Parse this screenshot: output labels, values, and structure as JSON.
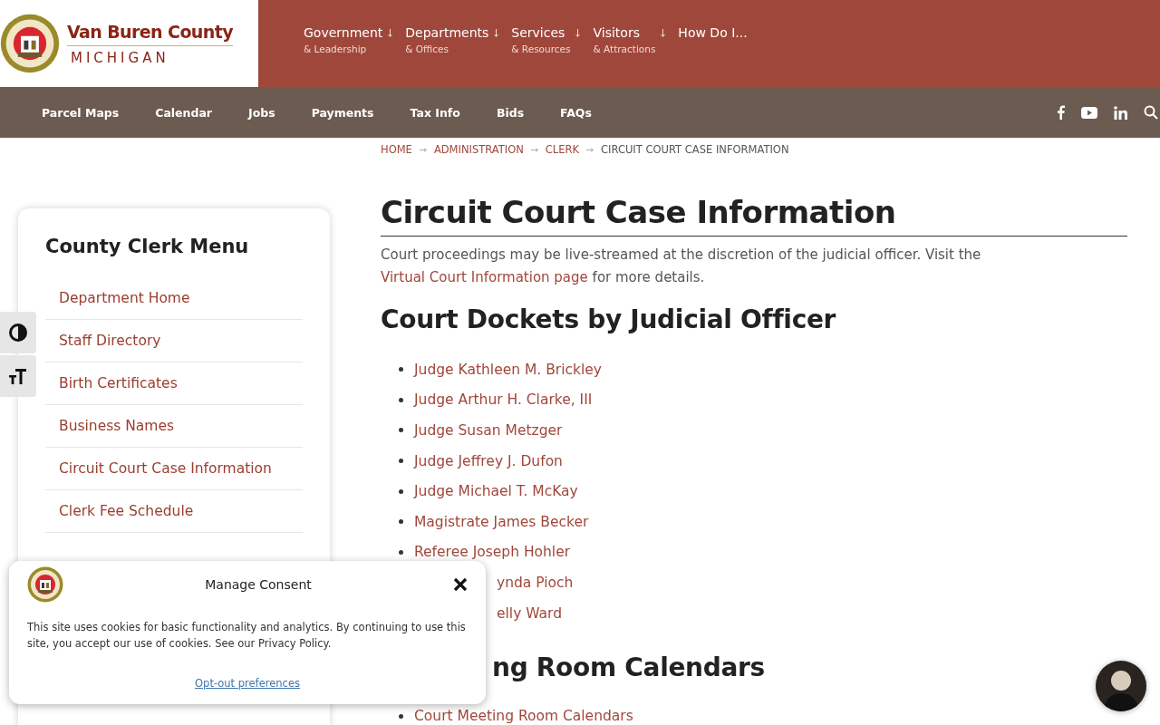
{
  "header": {
    "logo_title": "Van Buren County",
    "logo_subtitle": "MICHIGAN",
    "menu": [
      {
        "label": "Government",
        "sublabel": "& Leadership",
        "dropdown": true
      },
      {
        "label": "Departments",
        "sublabel": "& Offices",
        "dropdown": true
      },
      {
        "label": "Services",
        "sublabel": "& Resources",
        "dropdown": true
      },
      {
        "label": "Visitors",
        "sublabel": "& Attractions",
        "dropdown": true
      },
      {
        "label": "How Do I...",
        "dropdown": false
      }
    ]
  },
  "quick_links": [
    "Parcel Maps",
    "Calendar",
    "Jobs",
    "Payments",
    "Tax Info",
    "Bids",
    "FAQs"
  ],
  "breadcrumb": [
    {
      "label": "HOME",
      "link": true
    },
    {
      "label": "ADMINISTRATION",
      "link": true
    },
    {
      "label": "CLERK",
      "link": true
    },
    {
      "label": "CIRCUIT COURT CASE INFORMATION",
      "link": false
    }
  ],
  "sidebar": {
    "title": "County Clerk Menu",
    "items": [
      "Department Home",
      "Staff Directory",
      "Birth Certificates",
      "Business Names",
      "Circuit Court Case Information",
      "Clerk Fee Schedule"
    ]
  },
  "page": {
    "title": "Circuit Court Case Information",
    "intro_before": "Court proceedings may be live-streamed at the discretion of the judicial officer. Visit the ",
    "intro_link": "Virtual Court Information page",
    "intro_after": " for more details.",
    "content": [
      {
        "kind": "heading",
        "text": "Court Dockets by Judicial Officer"
      },
      {
        "kind": "link",
        "text": "Judge Kathleen M. Brickley"
      },
      {
        "kind": "link",
        "text": "Judge Arthur H. Clarke, III"
      },
      {
        "kind": "link",
        "text": "Judge Susan Metzger"
      },
      {
        "kind": "link",
        "text": "Judge Jeffrey J. Dufon"
      },
      {
        "kind": "link",
        "text": "Judge Michael T. McKay"
      },
      {
        "kind": "link",
        "text": "Magistrate James Becker"
      },
      {
        "kind": "link",
        "text": "Referee Joseph Hohler"
      },
      {
        "kind": "covered_link",
        "text": "ynda Pioch"
      },
      {
        "kind": "covered_link",
        "text": "elly Ward"
      },
      {
        "kind": "covered_heading",
        "text": "ng Room Calendars"
      },
      {
        "kind": "link",
        "text": "Court Meeting Room Calendars"
      }
    ]
  },
  "consent": {
    "title": "Manage Consent",
    "text": "This site uses cookies for basic functionality and analytics. By continuing to use this site, you accept our use of cookies. See our Privacy Policy.",
    "link": "Opt-out preferences"
  }
}
